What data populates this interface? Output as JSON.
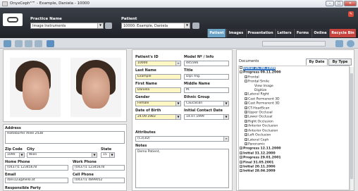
{
  "window": {
    "title": "OnyxCeph³™ - Example, Daniela - 10000",
    "min": "–",
    "max": "□",
    "close": "✕"
  },
  "header": {
    "practice_label": "Practice Name",
    "practice_value": "Image Instruments",
    "patient_label": "Patient",
    "patient_value": "10000: Example, Daniela",
    "badge": "✎"
  },
  "tabs": [
    "Patient",
    "Images",
    "Presentation",
    "Letters",
    "Forms",
    "Online",
    "Recycle Bin"
  ],
  "fields": {
    "patient_id_label": "Patient's ID",
    "patient_id": "10000",
    "model_label": "Model Nº / Info",
    "model": "445566",
    "last_name_label": "Last Name",
    "last_name": "Example",
    "title_label": "Title",
    "title": "Dipl.-Ing.",
    "first_name_label": "First Name",
    "first_name": "Daniela",
    "middle_name_label": "Middle Name",
    "middle_name": "M.",
    "gender_label": "Gender",
    "gender": "Female",
    "ethnic_label": "Ethnic Group",
    "ethnic": "Caucasian",
    "dob_label": "Date of Birth",
    "dob": "24.09.1983",
    "contact_label": "Initial Contact Date",
    "contact": "14.07.1999",
    "attributes_label": "Attributes",
    "attributes": "(C3)3D)",
    "notes_label": "Notes",
    "notes": "Demo Patient,"
  },
  "address": {
    "address_label": "Address",
    "address": "Holtebörfer Allee 2438",
    "zip_label": "Zip Code",
    "zip": "1090",
    "city_label": "City",
    "city": "Wien",
    "state_label": "State",
    "state": "15",
    "home_label": "Home Phone",
    "home": "(0437)1 12345678",
    "work_label": "Work Phone",
    "work": "(0437)1 12345678",
    "email_label": "Email",
    "email": "dani123@hello.at",
    "cell_label": "Cell Phone",
    "cell": "(0437)1 4899052",
    "resp_label": "Responsible Party"
  },
  "documents": {
    "label": "Documents",
    "tab_date": "By Date",
    "tab_type": "By Type",
    "tree": [
      {
        "t": "Initial 26.08.1999",
        "lvl": 0,
        "bold": true,
        "sel": true,
        "pm": "–"
      },
      {
        "t": "Progress 09.11.2000",
        "lvl": 0,
        "bold": true,
        "pm": "–"
      },
      {
        "t": "Frontal",
        "lvl": 1,
        "pm": "+"
      },
      {
        "t": "Frontal Smile",
        "lvl": 1,
        "pm": "–"
      },
      {
        "t": "View Image",
        "lvl": 3
      },
      {
        "t": "Digitize",
        "lvl": 3
      },
      {
        "t": "Lateral Right",
        "lvl": 1,
        "pm": "+"
      },
      {
        "t": "Cast Permanent 3D",
        "lvl": 1,
        "pm": "+"
      },
      {
        "t": "Cast Permanent 3D",
        "lvl": 1,
        "pm": "+"
      },
      {
        "t": "CT-HeadScan",
        "lvl": 1,
        "pm": "+"
      },
      {
        "t": "Upper Occlusal",
        "lvl": 1,
        "pm": "+"
      },
      {
        "t": "Lower Occlusal",
        "lvl": 1,
        "pm": "+"
      },
      {
        "t": "Right Occlusion",
        "lvl": 1,
        "pm": "+"
      },
      {
        "t": "Anterior Occlusion",
        "lvl": 1,
        "pm": "+"
      },
      {
        "t": "Anterior Occlusion",
        "lvl": 1,
        "pm": "+"
      },
      {
        "t": "Left Occlusion",
        "lvl": 1,
        "pm": "+"
      },
      {
        "t": "Lateral Ceph",
        "lvl": 1,
        "pm": "+"
      },
      {
        "t": "Panoramic",
        "lvl": 1,
        "pm": "+"
      },
      {
        "t": "Progress 12.11.2000",
        "lvl": 0,
        "bold": true,
        "pm": "+"
      },
      {
        "t": "Initial 31.12.2000",
        "lvl": 0,
        "bold": true,
        "pm": "+"
      },
      {
        "t": "Progress 29.01.2001",
        "lvl": 0,
        "bold": true,
        "pm": "+"
      },
      {
        "t": "Final 31.05.2001",
        "lvl": 0,
        "bold": true,
        "pm": "+"
      },
      {
        "t": "Initial 20.11.2006",
        "lvl": 0,
        "bold": true,
        "pm": "+"
      },
      {
        "t": "Initial 28.04.2009",
        "lvl": 0,
        "bold": true,
        "pm": "+"
      }
    ]
  },
  "icons": [
    "search-icon",
    "image-icon",
    "print-icon",
    "mail-icon",
    "save-icon",
    "settings-icon",
    "help-icon"
  ]
}
